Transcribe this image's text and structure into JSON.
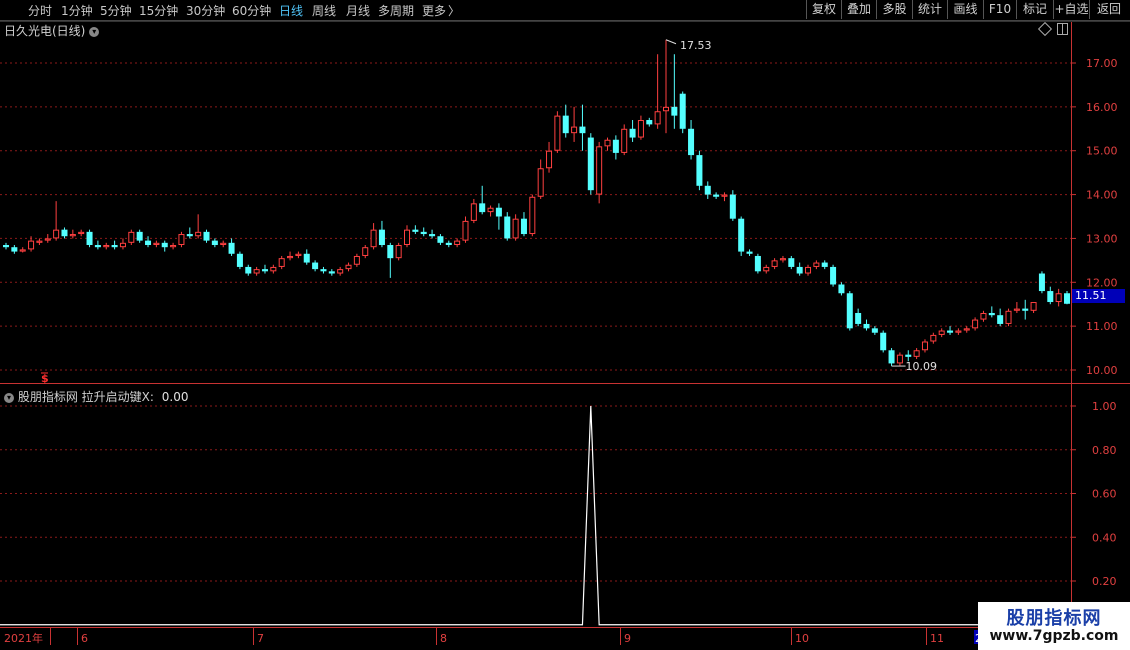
{
  "toolbar": {
    "periods": [
      "分时",
      "1分钟",
      "5分钟",
      "15分钟",
      "30分钟",
      "60分钟",
      "日线",
      "周线",
      "月线",
      "多周期",
      "更多"
    ],
    "more_chevron": "〉",
    "active_period": "日线",
    "buttons": [
      "复权",
      "叠加",
      "多股",
      "统计",
      "画线",
      "F10",
      "标记",
      "+自选",
      "返回"
    ]
  },
  "main_chart": {
    "title": "日久光电(日线)",
    "high_label": "17.53",
    "low_label": "10.09",
    "current_price": "11.51",
    "price_axis": [
      "17.00",
      "16.00",
      "15.00",
      "14.00",
      "13.00",
      "12.00",
      "11.00",
      "10.00"
    ],
    "marker_symbol": "$",
    "colors": {
      "up": "#ff4040",
      "down": "#54ffff",
      "grid": "#8b1a1a",
      "axis": "#c83232"
    }
  },
  "indicator": {
    "name": "股朋指标网",
    "series_label": "拉升启动键X:",
    "value": "0.00",
    "axis": [
      "1.00",
      "0.80",
      "0.60",
      "0.40",
      "0.20"
    ]
  },
  "date_axis": {
    "year": "2021年",
    "months": [
      "6",
      "7",
      "8",
      "9",
      "10",
      "11"
    ],
    "edge_label": "2"
  },
  "watermark": {
    "title": "股朋指标网",
    "url": "www.7gpzb.com"
  },
  "chart_data": {
    "type": "candlestick",
    "title": "日久光电(日线)",
    "ylim": [
      9.8,
      17.8
    ],
    "candles": [
      [
        12.85,
        12.9,
        12.8,
        12.75
      ],
      [
        12.8,
        12.85,
        12.7,
        12.65
      ],
      [
        12.7,
        12.8,
        12.75,
        12.68
      ],
      [
        12.75,
        13.05,
        12.95,
        12.7
      ],
      [
        12.9,
        13.0,
        12.95,
        12.85
      ],
      [
        12.95,
        13.1,
        13.0,
        12.9
      ],
      [
        13.0,
        13.85,
        13.2,
        12.95
      ],
      [
        13.2,
        13.25,
        13.05,
        13.0
      ],
      [
        13.05,
        13.2,
        13.1,
        13.0
      ],
      [
        13.1,
        13.2,
        13.15,
        13.05
      ],
      [
        13.15,
        13.2,
        12.85,
        12.8
      ],
      [
        12.85,
        12.95,
        12.8,
        12.75
      ],
      [
        12.8,
        12.9,
        12.85,
        12.75
      ],
      [
        12.85,
        12.95,
        12.8,
        12.75
      ],
      [
        12.8,
        13.0,
        12.9,
        12.75
      ],
      [
        12.9,
        13.2,
        13.15,
        12.85
      ],
      [
        13.15,
        13.2,
        12.95,
        12.9
      ],
      [
        12.95,
        13.05,
        12.85,
        12.8
      ],
      [
        12.85,
        12.95,
        12.9,
        12.8
      ],
      [
        12.9,
        12.95,
        12.8,
        12.7
      ],
      [
        12.8,
        12.9,
        12.85,
        12.75
      ],
      [
        12.85,
        13.15,
        13.1,
        12.8
      ],
      [
        13.1,
        13.25,
        13.05,
        13.0
      ],
      [
        13.05,
        13.55,
        13.15,
        13.0
      ],
      [
        13.15,
        13.2,
        12.95,
        12.9
      ],
      [
        12.95,
        13.0,
        12.85,
        12.8
      ],
      [
        12.85,
        12.95,
        12.9,
        12.8
      ],
      [
        12.9,
        13.0,
        12.65,
        12.6
      ],
      [
        12.65,
        12.7,
        12.35,
        12.3
      ],
      [
        12.35,
        12.4,
        12.2,
        12.15
      ],
      [
        12.2,
        12.35,
        12.3,
        12.15
      ],
      [
        12.3,
        12.4,
        12.25,
        12.2
      ],
      [
        12.25,
        12.4,
        12.35,
        12.2
      ],
      [
        12.35,
        12.6,
        12.55,
        12.3
      ],
      [
        12.55,
        12.7,
        12.6,
        12.5
      ],
      [
        12.6,
        12.7,
        12.65,
        12.55
      ],
      [
        12.65,
        12.75,
        12.45,
        12.4
      ],
      [
        12.45,
        12.5,
        12.3,
        12.25
      ],
      [
        12.3,
        12.35,
        12.25,
        12.2
      ],
      [
        12.25,
        12.3,
        12.2,
        12.15
      ],
      [
        12.2,
        12.35,
        12.3,
        12.15
      ],
      [
        12.3,
        12.45,
        12.4,
        12.25
      ],
      [
        12.4,
        12.65,
        12.6,
        12.35
      ],
      [
        12.6,
        12.85,
        12.8,
        12.55
      ],
      [
        12.8,
        13.35,
        13.2,
        12.75
      ],
      [
        13.2,
        13.4,
        12.85,
        12.8
      ],
      [
        12.85,
        12.9,
        12.55,
        12.1
      ],
      [
        12.55,
        12.9,
        12.85,
        12.5
      ],
      [
        12.85,
        13.3,
        13.2,
        12.8
      ],
      [
        13.2,
        13.3,
        13.15,
        13.1
      ],
      [
        13.15,
        13.25,
        13.1,
        13.05
      ],
      [
        13.1,
        13.2,
        13.05,
        13.0
      ],
      [
        13.05,
        13.1,
        12.9,
        12.85
      ],
      [
        12.9,
        12.95,
        12.85,
        12.8
      ],
      [
        12.85,
        13.0,
        12.95,
        12.8
      ],
      [
        12.95,
        13.5,
        13.4,
        12.9
      ],
      [
        13.4,
        13.9,
        13.8,
        13.35
      ],
      [
        13.8,
        14.2,
        13.6,
        13.55
      ],
      [
        13.6,
        13.75,
        13.7,
        13.5
      ],
      [
        13.7,
        13.8,
        13.5,
        13.2
      ],
      [
        13.5,
        13.6,
        13.0,
        12.95
      ],
      [
        13.0,
        13.55,
        13.45,
        12.95
      ],
      [
        13.45,
        13.6,
        13.1,
        13.05
      ],
      [
        13.1,
        14.0,
        13.95,
        13.05
      ],
      [
        13.95,
        14.8,
        14.6,
        13.9
      ],
      [
        14.6,
        15.2,
        15.0,
        14.5
      ],
      [
        15.0,
        15.9,
        15.8,
        14.95
      ],
      [
        15.8,
        16.05,
        15.4,
        15.3
      ],
      [
        15.4,
        16.0,
        15.55,
        15.2
      ],
      [
        15.55,
        16.05,
        15.4,
        15.0
      ],
      [
        15.3,
        15.4,
        14.1,
        14.0
      ],
      [
        14.0,
        15.2,
        15.1,
        13.8
      ],
      [
        15.1,
        15.3,
        15.25,
        15.0
      ],
      [
        15.25,
        15.35,
        14.95,
        14.8
      ],
      [
        14.95,
        15.6,
        15.5,
        14.9
      ],
      [
        15.5,
        15.7,
        15.3,
        15.2
      ],
      [
        15.3,
        15.8,
        15.7,
        15.25
      ],
      [
        15.7,
        15.75,
        15.6,
        15.55
      ],
      [
        15.6,
        17.2,
        15.9,
        15.5
      ],
      [
        15.9,
        17.53,
        16.0,
        15.4
      ],
      [
        16.0,
        17.2,
        15.8,
        15.5
      ],
      [
        16.3,
        16.35,
        15.5,
        15.4
      ],
      [
        15.5,
        15.7,
        14.9,
        14.8
      ],
      [
        14.9,
        15.0,
        14.2,
        14.1
      ],
      [
        14.2,
        14.3,
        14.0,
        13.9
      ],
      [
        14.0,
        14.05,
        13.95,
        13.9
      ],
      [
        13.95,
        14.05,
        14.0,
        13.85
      ],
      [
        14.0,
        14.1,
        13.45,
        13.4
      ],
      [
        13.45,
        13.5,
        12.7,
        12.6
      ],
      [
        12.7,
        12.75,
        12.65,
        12.6
      ],
      [
        12.6,
        12.65,
        12.25,
        12.2
      ],
      [
        12.25,
        12.4,
        12.35,
        12.2
      ],
      [
        12.35,
        12.55,
        12.5,
        12.3
      ],
      [
        12.5,
        12.6,
        12.55,
        12.45
      ],
      [
        12.55,
        12.6,
        12.35,
        12.3
      ],
      [
        12.35,
        12.45,
        12.2,
        12.15
      ],
      [
        12.2,
        12.4,
        12.35,
        12.15
      ],
      [
        12.35,
        12.5,
        12.45,
        12.3
      ],
      [
        12.45,
        12.5,
        12.35,
        12.3
      ],
      [
        12.35,
        12.4,
        11.95,
        11.9
      ],
      [
        11.95,
        12.0,
        11.75,
        11.7
      ],
      [
        11.75,
        11.8,
        10.95,
        10.9
      ],
      [
        11.3,
        11.4,
        11.05,
        11.0
      ],
      [
        11.05,
        11.15,
        10.95,
        10.9
      ],
      [
        10.95,
        11.0,
        10.85,
        10.8
      ],
      [
        10.85,
        10.9,
        10.45,
        10.4
      ],
      [
        10.45,
        10.5,
        10.15,
        10.09
      ],
      [
        10.15,
        10.4,
        10.35,
        10.1
      ],
      [
        10.35,
        10.45,
        10.3,
        10.2
      ],
      [
        10.3,
        10.5,
        10.45,
        10.25
      ],
      [
        10.45,
        10.7,
        10.65,
        10.4
      ],
      [
        10.65,
        10.85,
        10.8,
        10.6
      ],
      [
        10.8,
        10.95,
        10.9,
        10.75
      ],
      [
        10.9,
        11.0,
        10.85,
        10.8
      ],
      [
        10.85,
        10.95,
        10.9,
        10.8
      ],
      [
        10.9,
        11.0,
        10.95,
        10.85
      ],
      [
        10.95,
        11.2,
        11.15,
        10.9
      ],
      [
        11.15,
        11.35,
        11.3,
        11.1
      ],
      [
        11.3,
        11.45,
        11.25,
        11.2
      ],
      [
        11.25,
        11.4,
        11.05,
        11.0
      ],
      [
        11.05,
        11.4,
        11.35,
        11.0
      ],
      [
        11.35,
        11.55,
        11.4,
        11.3
      ],
      [
        11.4,
        11.6,
        11.35,
        11.15
      ],
      [
        11.35,
        11.5,
        11.55,
        11.3
      ],
      [
        12.2,
        12.25,
        11.8,
        11.75
      ],
      [
        11.8,
        11.9,
        11.55,
        11.5
      ],
      [
        11.55,
        11.85,
        11.75,
        11.45
      ],
      [
        11.75,
        11.8,
        11.51,
        11.5
      ]
    ],
    "indicator_series": {
      "name": "拉升启动键X",
      "ylim": [
        0,
        1.05
      ],
      "spike_index": 70,
      "values_note_free": true
    }
  }
}
